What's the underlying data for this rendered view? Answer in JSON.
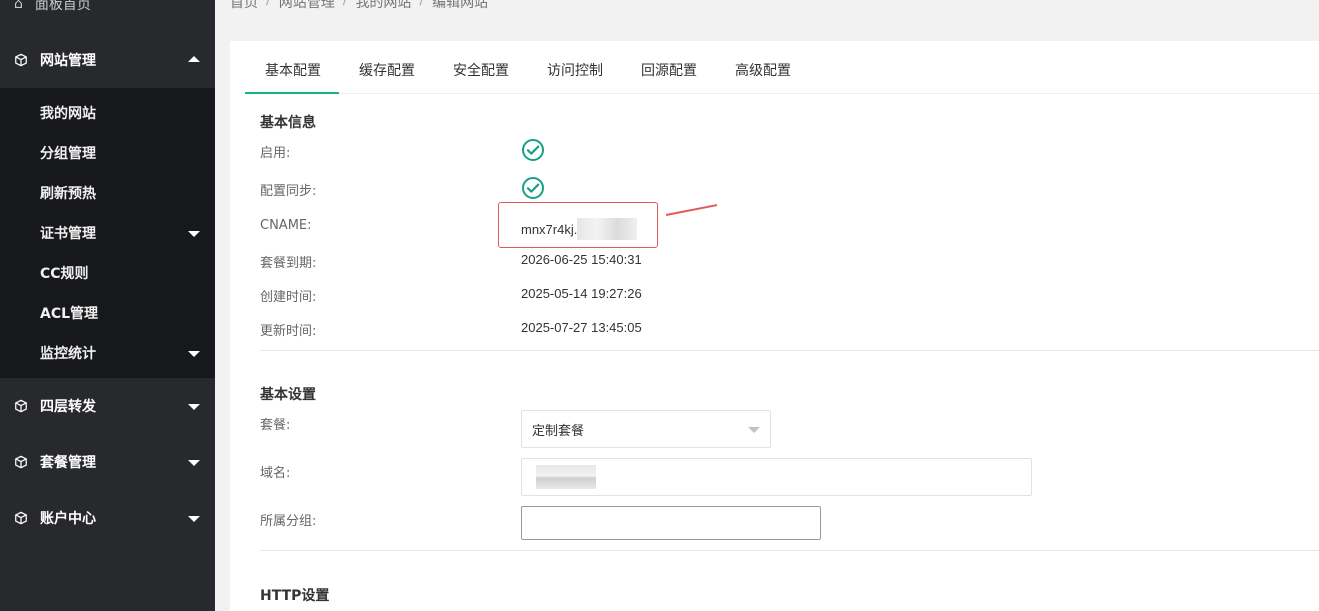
{
  "sidebar": {
    "top_item": "面板首页",
    "groups": [
      {
        "label": "网站管理",
        "expanded": true
      },
      {
        "label": "四层转发",
        "expanded": false
      },
      {
        "label": "套餐管理",
        "expanded": false
      },
      {
        "label": "账户中心",
        "expanded": false
      }
    ],
    "sub_items": [
      "我的网站",
      "分组管理",
      "刷新预热",
      "证书管理",
      "CC规则",
      "ACL管理",
      "监控统计"
    ]
  },
  "breadcrumb": [
    "首页",
    "网站管理",
    "我的网站",
    "编辑网站"
  ],
  "tabs": [
    "基本配置",
    "缓存配置",
    "安全配置",
    "访问控制",
    "回源配置",
    "高级配置"
  ],
  "basic_info": {
    "title": "基本信息",
    "enabled_label": "启用:",
    "sync_label": "配置同步:",
    "cname_label": "CNAME:",
    "cname_value": "mnx7r4kj.",
    "expire_label": "套餐到期:",
    "expire_value": "2026-06-25 15:40:31",
    "created_label": "创建时间:",
    "created_value": "2025-05-14 19:27:26",
    "updated_label": "更新时间:",
    "updated_value": "2025-07-27 13:45:05"
  },
  "basic_settings": {
    "title": "基本设置",
    "plan_label": "套餐:",
    "plan_value": "定制套餐",
    "domain_label": "域名:",
    "group_label": "所属分组:"
  },
  "http_settings": {
    "title": "HTTP设置"
  },
  "colors": {
    "sidebar_bg": "#28292d",
    "sidebar_sub_bg": "#17181b",
    "accent": "#16b777",
    "highlight": "#e05a5a"
  }
}
